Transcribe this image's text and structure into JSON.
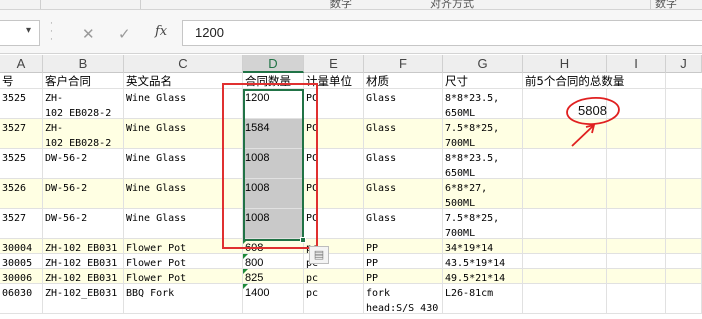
{
  "ribbon": {
    "fragments": [
      "",
      "",
      "",
      "数字",
      "对齐方式",
      "数字"
    ]
  },
  "formula_bar": {
    "name_box": "",
    "name_box_dropdown": "▾",
    "cancel_icon": "✕",
    "enter_icon": "✓",
    "fx_label": "fx",
    "value": "1200"
  },
  "columns": [
    {
      "label": "A",
      "selected": false
    },
    {
      "label": "B",
      "selected": false
    },
    {
      "label": "C",
      "selected": false
    },
    {
      "label": "D",
      "selected": true
    },
    {
      "label": "E",
      "selected": false
    },
    {
      "label": "F",
      "selected": false
    },
    {
      "label": "G",
      "selected": false
    },
    {
      "label": "H",
      "selected": false
    },
    {
      "label": "I",
      "selected": false
    },
    {
      "label": "J",
      "selected": false
    }
  ],
  "header_row": [
    "号",
    "客户合同",
    "英文品名",
    "合同数量",
    "计量单位",
    "材质",
    "尺寸",
    "前5个合同的总数量"
  ],
  "rows": [
    {
      "a": "3525",
      "b": "ZH-\n102_EB028-2",
      "c": "Wine Glass",
      "d": "1200",
      "e": "PC",
      "f": "Glass",
      "g": "8*8*23.5,\n650ML"
    },
    {
      "a": "3527",
      "b": "ZH-\n102_EB028-2",
      "c": "Wine Glass",
      "d": "1584",
      "e": "PC",
      "f": "Glass",
      "g": "7.5*8*25,\n700ML"
    },
    {
      "a": "3525",
      "b": "DW-56-2",
      "c": "Wine Glass",
      "d": "1008",
      "e": "PC",
      "f": "Glass",
      "g": "8*8*23.5,\n650ML"
    },
    {
      "a": "3526",
      "b": "DW-56-2",
      "c": "Wine Glass",
      "d": "1008",
      "e": "PC",
      "f": "Glass",
      "g": "6*8*27,\n500ML"
    },
    {
      "a": "3527",
      "b": "DW-56-2",
      "c": "Wine Glass",
      "d": "1008",
      "e": "PC",
      "f": "Glass",
      "g": "7.5*8*25,\n700ML"
    },
    {
      "a": "30004",
      "b": "ZH-102_EB031",
      "c": "Flower Pot",
      "d": "608",
      "e": "pc",
      "f": "PP",
      "g": "34*19*14"
    },
    {
      "a": "30005",
      "b": "ZH-102_EB031",
      "c": "Flower Pot",
      "d": "800",
      "e": "pc",
      "f": "PP",
      "g": "43.5*19*14"
    },
    {
      "a": "30006",
      "b": "ZH-102_EB031",
      "c": "Flower Pot",
      "d": "825",
      "e": "pc",
      "f": "PP",
      "g": "49.5*21*14"
    },
    {
      "a": "06030",
      "b": "ZH-102_EB031",
      "c": "BBQ Fork",
      "d": "1400",
      "e": "pc",
      "f": "fork\nhead:S/S 430",
      "g": "L26-81cm"
    }
  ],
  "annotation": {
    "total_value": "5808",
    "ink_color": "#e02020"
  },
  "colors": {
    "selection": "#217346",
    "highlight_box": "#e03030",
    "alt_row": "#ffffe3"
  }
}
